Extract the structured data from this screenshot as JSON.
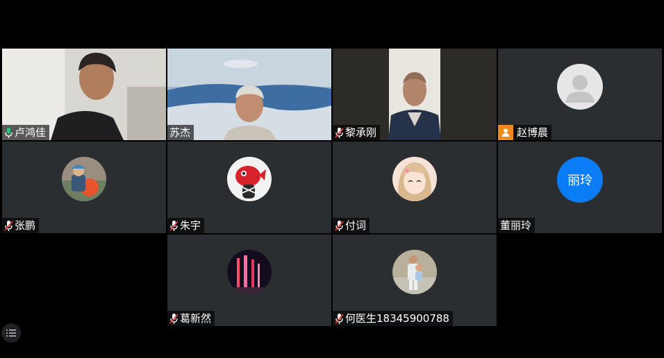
{
  "participants": [
    {
      "name": "卢鸿佳",
      "type": "video",
      "mic": "active"
    },
    {
      "name": "苏杰",
      "type": "video",
      "mic": "none"
    },
    {
      "name": "黎承刚",
      "type": "video",
      "mic": "muted"
    },
    {
      "name": "赵博晨",
      "type": "default-avatar",
      "mic": "none",
      "badge": "user-icon"
    },
    {
      "name": "张鹏",
      "type": "avatar",
      "mic": "muted"
    },
    {
      "name": "朱宇",
      "type": "avatar",
      "mic": "muted"
    },
    {
      "name": "付词",
      "type": "avatar",
      "mic": "muted"
    },
    {
      "name": "董丽玲",
      "type": "initials",
      "mic": "none",
      "initials": "丽玲",
      "color": "#0a7cf5"
    },
    {
      "name": "葛新然",
      "type": "avatar",
      "mic": "muted"
    },
    {
      "name": "何医生18345900788",
      "type": "avatar",
      "mic": "muted"
    }
  ],
  "controls": {
    "participant_list_icon": "list-icon"
  },
  "colors": {
    "active_speaker": "#2ec27e",
    "tile_bg": "#2b2e31",
    "badge": "#f08a1c"
  }
}
